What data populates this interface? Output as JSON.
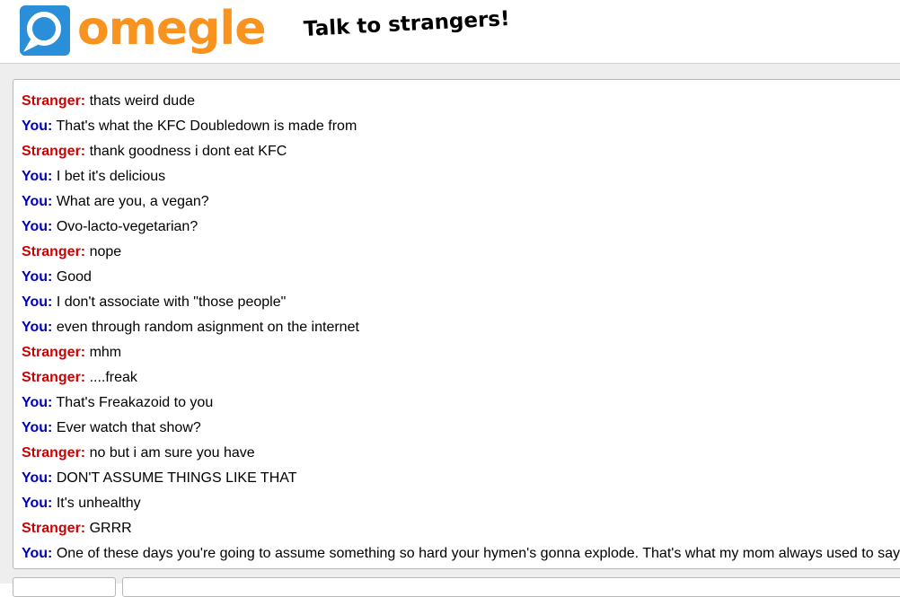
{
  "header": {
    "brand": "omegle",
    "tagline": "Talk to strangers!",
    "logo_icon": "omegle-chat-bubble-icon",
    "colors": {
      "brand_orange": "#f7931e",
      "logo_blue": "#2a8ed8"
    }
  },
  "chat": {
    "colors": {
      "stranger": "#d00000",
      "you": "#0000b0"
    },
    "messages": [
      {
        "speaker": "Stranger:",
        "role": "stranger",
        "text": "thats weird dude"
      },
      {
        "speaker": "You:",
        "role": "you",
        "text": "That's what the KFC Doubledown is made from"
      },
      {
        "speaker": "Stranger:",
        "role": "stranger",
        "text": "thank goodness i dont eat KFC"
      },
      {
        "speaker": "You:",
        "role": "you",
        "text": "I bet it's delicious"
      },
      {
        "speaker": "You:",
        "role": "you",
        "text": "What are you, a vegan?"
      },
      {
        "speaker": "You:",
        "role": "you",
        "text": "Ovo-lacto-vegetarian?"
      },
      {
        "speaker": "Stranger:",
        "role": "stranger",
        "text": "nope"
      },
      {
        "speaker": "You:",
        "role": "you",
        "text": "Good"
      },
      {
        "speaker": "You:",
        "role": "you",
        "text": "I don't associate with \"those people\""
      },
      {
        "speaker": "You:",
        "role": "you",
        "text": "even through random asignment on the internet"
      },
      {
        "speaker": "Stranger:",
        "role": "stranger",
        "text": "mhm"
      },
      {
        "speaker": "Stranger:",
        "role": "stranger",
        "text": "....freak"
      },
      {
        "speaker": "You:",
        "role": "you",
        "text": "That's Freakazoid to you"
      },
      {
        "speaker": "You:",
        "role": "you",
        "text": "Ever watch that show?"
      },
      {
        "speaker": "Stranger:",
        "role": "stranger",
        "text": "no but i am sure you have"
      },
      {
        "speaker": "You:",
        "role": "you",
        "text": "DON'T ASSUME THINGS LIKE THAT"
      },
      {
        "speaker": "You:",
        "role": "you",
        "text": "It's unhealthy"
      },
      {
        "speaker": "Stranger:",
        "role": "stranger",
        "text": "GRRR"
      },
      {
        "speaker": "You:",
        "role": "you",
        "text": "One of these days you're going to assume something so hard your hymen's gonna explode. That's what my mom always used to say."
      }
    ]
  }
}
